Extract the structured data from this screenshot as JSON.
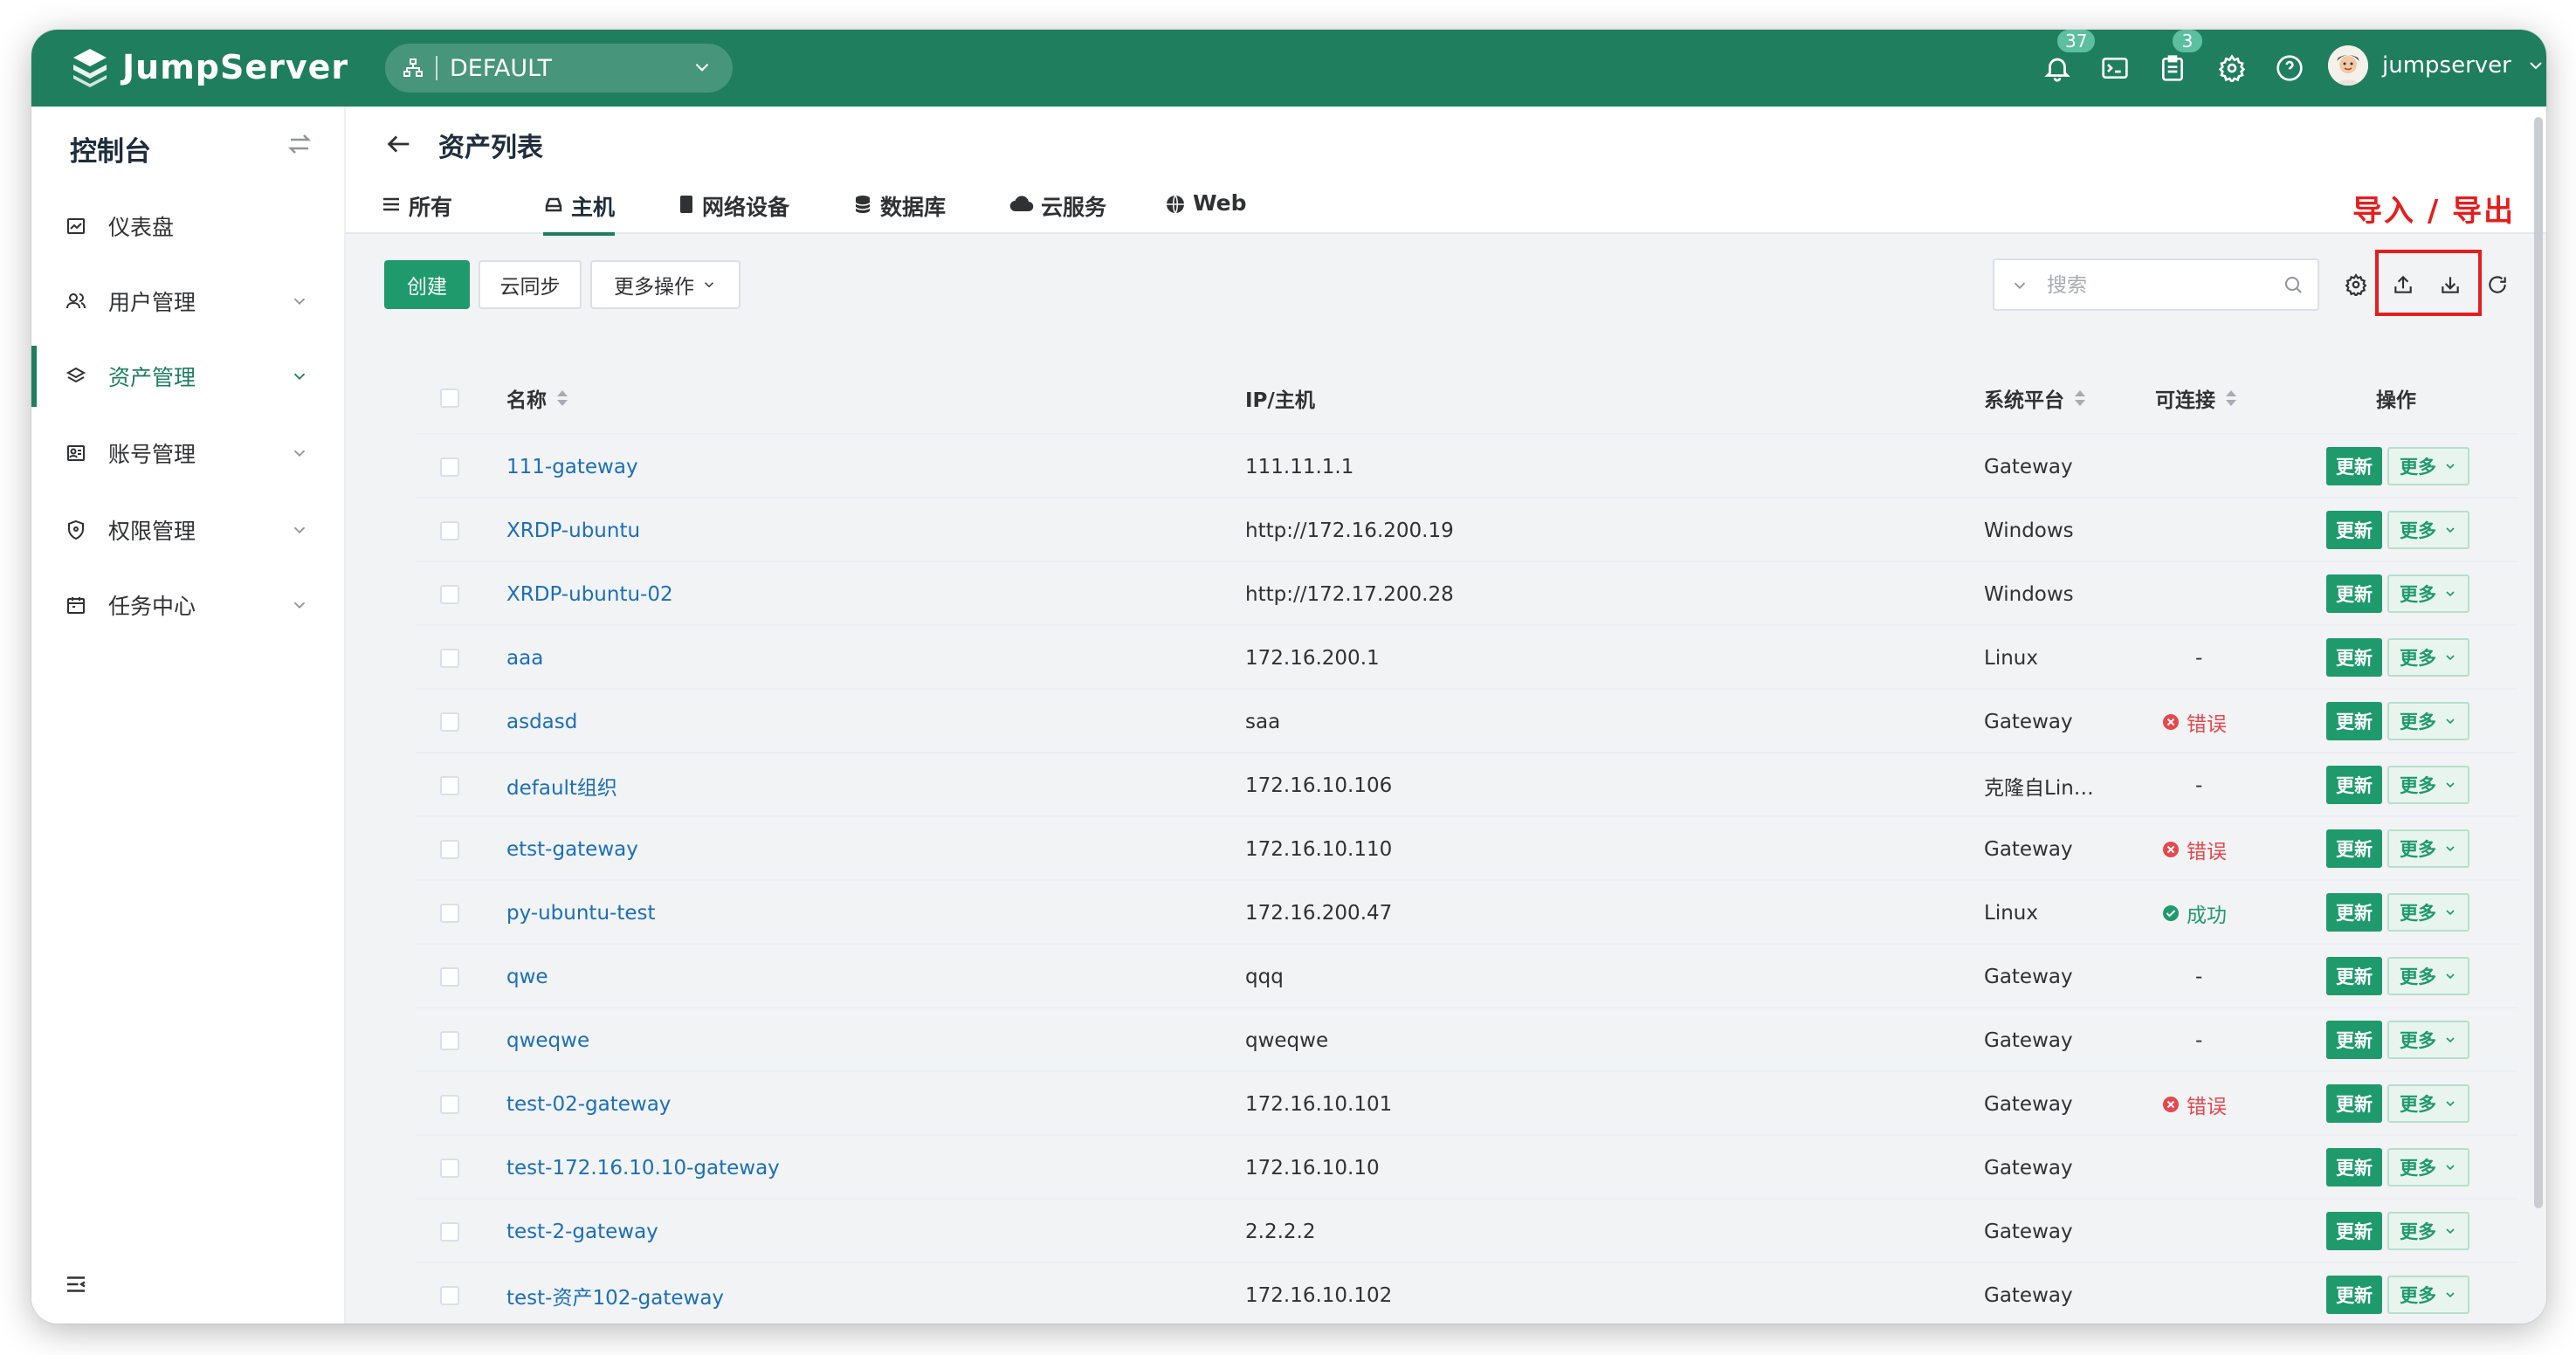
{
  "header": {
    "brand": "JumpServer",
    "org": "DEFAULT",
    "notifications_count": "37",
    "tickets_count": "3",
    "username": "jumpserver"
  },
  "sidebar": {
    "title": "控制台",
    "items": [
      {
        "label": "仪表盘",
        "icon": "chart-icon"
      },
      {
        "label": "用户管理",
        "icon": "users-icon"
      },
      {
        "label": "资产管理",
        "icon": "layers-icon"
      },
      {
        "label": "账号管理",
        "icon": "account-icon"
      },
      {
        "label": "权限管理",
        "icon": "shield-icon"
      },
      {
        "label": "任务中心",
        "icon": "calendar-icon"
      }
    ]
  },
  "page": {
    "title": "资产列表",
    "annotation": "导入 / 导出",
    "tabs": [
      {
        "label": "所有",
        "icon": "list-icon"
      },
      {
        "label": "主机",
        "icon": "host-icon"
      },
      {
        "label": "网络设备",
        "icon": "device-icon"
      },
      {
        "label": "数据库",
        "icon": "database-icon"
      },
      {
        "label": "云服务",
        "icon": "cloud-icon"
      },
      {
        "label": "Web",
        "icon": "globe-icon"
      }
    ]
  },
  "toolbar": {
    "create": "创建",
    "cloud_sync": "云同步",
    "more_actions": "更多操作",
    "search_placeholder": "搜索"
  },
  "table": {
    "columns": [
      "名称",
      "IP/主机",
      "系统平台",
      "可连接",
      "操作"
    ],
    "update_label": "更新",
    "more_label": "更多",
    "rows": [
      {
        "name": "111-gateway",
        "ip": "111.11.1.1",
        "platform": "Gateway",
        "status": "",
        "status_type": "none"
      },
      {
        "name": "XRDP-ubuntu",
        "ip": "http://172.16.200.19",
        "platform": "Windows",
        "status": "",
        "status_type": "none"
      },
      {
        "name": "XRDP-ubuntu-02",
        "ip": "http://172.17.200.28",
        "platform": "Windows",
        "status": "",
        "status_type": "none"
      },
      {
        "name": "aaa",
        "ip": "172.16.200.1",
        "platform": "Linux",
        "status": "-",
        "status_type": "dash"
      },
      {
        "name": "asdasd",
        "ip": "saa",
        "platform": "Gateway",
        "status": "错误",
        "status_type": "err"
      },
      {
        "name": "default组织",
        "ip": "172.16.10.106",
        "platform": "克隆自Lin…",
        "status": "-",
        "status_type": "dash"
      },
      {
        "name": "etst-gateway",
        "ip": "172.16.10.110",
        "platform": "Gateway",
        "status": "错误",
        "status_type": "err"
      },
      {
        "name": "py-ubuntu-test",
        "ip": "172.16.200.47",
        "platform": "Linux",
        "status": "成功",
        "status_type": "ok"
      },
      {
        "name": "qwe",
        "ip": "qqq",
        "platform": "Gateway",
        "status": "-",
        "status_type": "dash"
      },
      {
        "name": "qweqwe",
        "ip": "qweqwe",
        "platform": "Gateway",
        "status": "-",
        "status_type": "dash"
      },
      {
        "name": "test-02-gateway",
        "ip": "172.16.10.101",
        "platform": "Gateway",
        "status": "错误",
        "status_type": "err"
      },
      {
        "name": "test-172.16.10.10-gateway",
        "ip": "172.16.10.10",
        "platform": "Gateway",
        "status": "",
        "status_type": "none"
      },
      {
        "name": "test-2-gateway",
        "ip": "2.2.2.2",
        "platform": "Gateway",
        "status": "",
        "status_type": "none"
      },
      {
        "name": "test-资产102-gateway",
        "ip": "172.16.10.102",
        "platform": "Gateway",
        "status": "",
        "status_type": "none"
      }
    ]
  },
  "colors": {
    "brand": "#1f7e5d",
    "primary_button": "#1f9a6c",
    "link": "#1b6fb8",
    "error": "#e5484d",
    "annotation": "#e41e1e"
  }
}
